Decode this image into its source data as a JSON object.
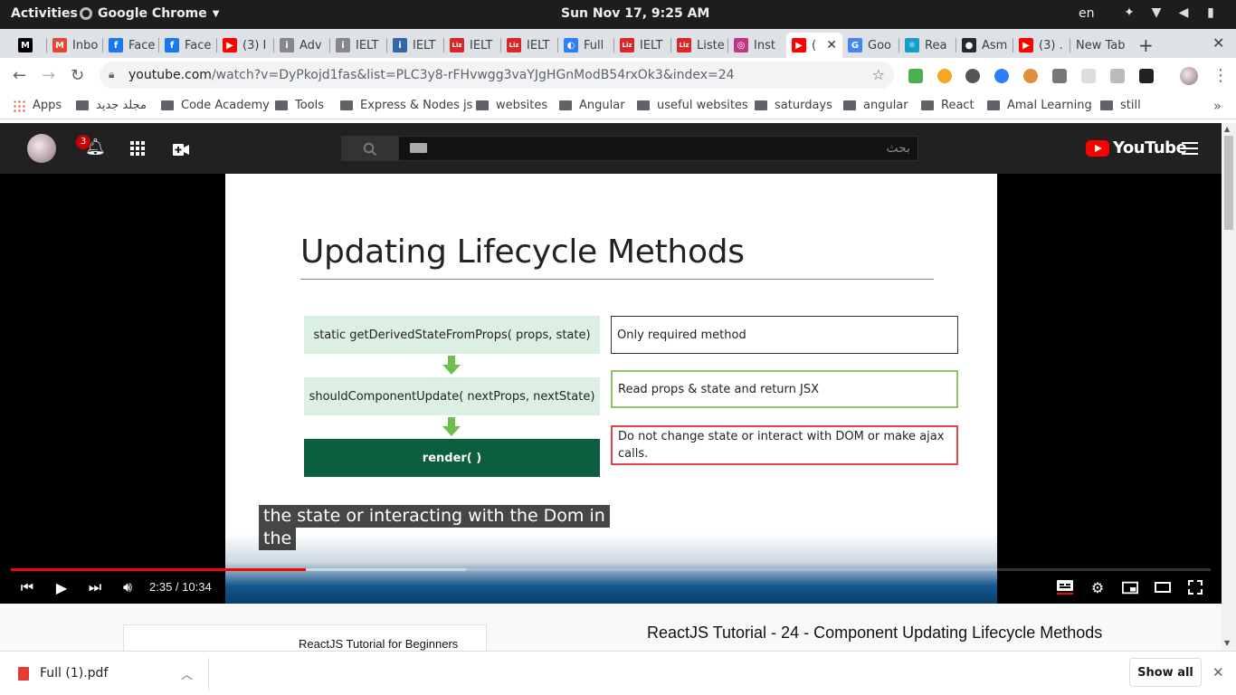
{
  "system": {
    "activities": "Activities",
    "app_name": "Google Chrome",
    "clock": "Sun Nov 17,  9:25 AM",
    "lang": "en"
  },
  "tabs": [
    {
      "label": "",
      "favicon": "M",
      "color": "#000000",
      "icon": "medium-icon"
    },
    {
      "label": "Inbo",
      "favicon": "M",
      "color": "#ea4335",
      "icon": "gmail-icon"
    },
    {
      "label": "Face",
      "favicon": "f",
      "color": "#1877f2",
      "icon": "facebook-icon"
    },
    {
      "label": "Face",
      "favicon": "f",
      "color": "#1877f2",
      "icon": "facebook-icon"
    },
    {
      "label": "(3) I",
      "favicon": "▶",
      "color": "#ff0000",
      "icon": "youtube-icon"
    },
    {
      "label": "Adv",
      "favicon": "i",
      "color": "#888888",
      "icon": "ielts-icon"
    },
    {
      "label": "IELT",
      "favicon": "i",
      "color": "#888888",
      "icon": "ielts-icon"
    },
    {
      "label": "IELT",
      "favicon": "i",
      "color": "#3366aa",
      "icon": "ielts-icon"
    },
    {
      "label": "IELT",
      "favicon": "Liz",
      "color": "#d62828",
      "icon": "liz-icon"
    },
    {
      "label": "IELT",
      "favicon": "Liz",
      "color": "#d62828",
      "icon": "liz-icon"
    },
    {
      "label": "Full",
      "favicon": "◐",
      "color": "#2d7ff9",
      "icon": "full-icon"
    },
    {
      "label": "IELT",
      "favicon": "Liz",
      "color": "#d62828",
      "icon": "liz-icon"
    },
    {
      "label": "Liste",
      "favicon": "Liz",
      "color": "#d62828",
      "icon": "liz-icon"
    },
    {
      "label": "Inst",
      "favicon": "◎",
      "color": "#c13584",
      "icon": "instagram-icon"
    },
    {
      "label": "(",
      "favicon": "▶",
      "color": "#ff0000",
      "icon": "youtube-icon",
      "active": true
    },
    {
      "label": "Goo",
      "favicon": "G",
      "color": "#4285f4",
      "icon": "google-translate-icon"
    },
    {
      "label": "Rea",
      "favicon": "⚛",
      "color": "#149eca",
      "icon": "react-icon"
    },
    {
      "label": "Asm",
      "favicon": "●",
      "color": "#24292e",
      "icon": "github-icon"
    },
    {
      "label": "‫. (3)",
      "favicon": "▶",
      "color": "#ff0000",
      "icon": "youtube-icon"
    },
    {
      "label": "New Tab",
      "favicon": "",
      "color": "transparent",
      "icon": "newtab-icon"
    }
  ],
  "toolbar": {
    "url_host": "youtube.com",
    "url_path": "/watch?v=DyPkojd1fas&list=PLC3y8-rFHvwgg3vaYJgHGnModB54rxOk3&index=24"
  },
  "bookmarks": [
    {
      "label": "Apps"
    },
    {
      "label": "مجلد جديد"
    },
    {
      "label": "Code Academy"
    },
    {
      "label": "Tools"
    },
    {
      "label": "Express & Nodes js"
    },
    {
      "label": "websites"
    },
    {
      "label": "Angular"
    },
    {
      "label": "useful websites"
    },
    {
      "label": "saturdays"
    },
    {
      "label": "angular"
    },
    {
      "label": "React"
    },
    {
      "label": "Amal Learning"
    },
    {
      "label": "still"
    }
  ],
  "youtube": {
    "notification_count": "3",
    "search_placeholder": "بحث",
    "logo_text": "YouTube"
  },
  "slide": {
    "title": "Updating Lifecycle Methods",
    "methods": [
      "static getDerivedStateFromProps( props, state)",
      "shouldComponentUpdate( nextProps, nextState)",
      "render( )"
    ],
    "notes": [
      "Only required method",
      "Read props & state and return JSX",
      "Do not change state or interact with DOM or make ajax calls."
    ],
    "note_colors": [
      "#333333",
      "#8cc36b",
      "#e04848"
    ]
  },
  "caption": {
    "line1": "the state or interacting with the Dom in",
    "line2": "the"
  },
  "player": {
    "time_current": "2:35",
    "time_total": "10:34",
    "time_display": "2:35 / 10:34",
    "played_fraction": 0.246,
    "buffered_fraction": 0.379
  },
  "page": {
    "playlist_title": "ReactJS Tutorial for Beginners",
    "video_title": "ReactJS Tutorial - 24 - Component Updating Lifecycle Methods"
  },
  "downloads": {
    "file_name": "Full (1).pdf",
    "show_all": "Show all"
  }
}
